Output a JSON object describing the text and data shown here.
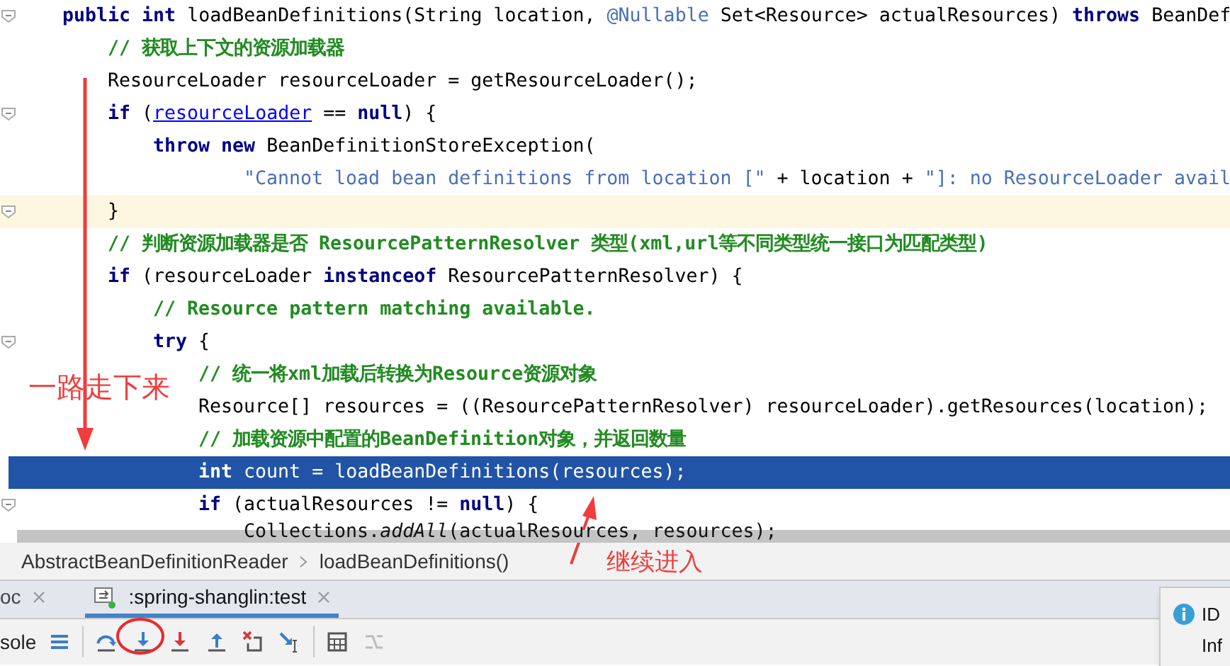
{
  "editor": {
    "lines": [
      {
        "kind": "normal",
        "segments": [
          {
            "kind": "keyword",
            "text": "public int"
          },
          {
            "kind": "plain",
            "text": " loadBeanDefinitions(String location, "
          },
          {
            "kind": "annotation",
            "text": "@Nullable"
          },
          {
            "kind": "plain",
            "text": " Set<Resource> actualResources) "
          },
          {
            "kind": "keyword",
            "text": "throws"
          },
          {
            "kind": "plain",
            "text": " BeanDef"
          }
        ],
        "children": [
          {
            "kind": "normal",
            "segments": [
              {
                "kind": "comment",
                "text": "// 获取上下文的资源加载器"
              }
            ]
          },
          {
            "kind": "normal",
            "segments": [
              {
                "kind": "plain",
                "text": "ResourceLoader resourceLoader = getResourceLoader();"
              }
            ]
          },
          {
            "kind": "normal",
            "segments": [
              {
                "kind": "keyword",
                "text": "if"
              },
              {
                "kind": "plain",
                "text": " ("
              },
              {
                "kind": "link",
                "text": "resourceLoader"
              },
              {
                "kind": "plain",
                "text": " == "
              },
              {
                "kind": "keyword",
                "text": "null"
              },
              {
                "kind": "plain",
                "text": ") {"
              }
            ],
            "children": [
              {
                "kind": "normal",
                "segments": [
                  {
                    "kind": "keyword",
                    "text": "throw new"
                  },
                  {
                    "kind": "plain",
                    "text": " BeanDefinitionStoreException("
                  }
                ],
                "children": [
                  {
                    "kind": "continuation",
                    "segments": [
                      {
                        "kind": "string",
                        "text": "\"Cannot load bean definitions from location [\""
                      },
                      {
                        "kind": "plain",
                        "text": " + location + "
                      },
                      {
                        "kind": "string",
                        "text": "\"]: no ResourceLoader avail"
                      }
                    ]
                  }
                ]
              }
            ]
          },
          {
            "kind": "caret",
            "segments": [
              {
                "kind": "plain",
                "text": "}"
              }
            ]
          },
          {
            "kind": "normal",
            "segments": [
              {
                "kind": "comment",
                "text": "// 判断资源加载器是否  ResourcePatternResolver 类型(xml,url等不同类型统一接口为匹配类型)"
              }
            ]
          },
          {
            "kind": "normal",
            "segments": [
              {
                "kind": "keyword",
                "text": "if"
              },
              {
                "kind": "plain",
                "text": " (resourceLoader "
              },
              {
                "kind": "keyword",
                "text": "instanceof"
              },
              {
                "kind": "plain",
                "text": " ResourcePatternResolver) {"
              }
            ],
            "children": [
              {
                "kind": "normal",
                "segments": [
                  {
                    "kind": "comment",
                    "text": "// Resource pattern matching available."
                  }
                ]
              },
              {
                "kind": "normal",
                "segments": [
                  {
                    "kind": "keyword",
                    "text": "try"
                  },
                  {
                    "kind": "plain",
                    "text": " {"
                  }
                ],
                "children": [
                  {
                    "kind": "normal",
                    "segments": [
                      {
                        "kind": "comment",
                        "text": "// 统一将xml加载后转换为Resource资源对象"
                      }
                    ]
                  },
                  {
                    "kind": "normal",
                    "segments": [
                      {
                        "kind": "plain",
                        "text": "Resource[] resources = ((ResourcePatternResolver) resourceLoader).getResources(location);"
                      }
                    ]
                  },
                  {
                    "kind": "normal",
                    "segments": [
                      {
                        "kind": "comment",
                        "text": "// 加载资源中配置的BeanDefinition对象，并返回数量"
                      }
                    ]
                  },
                  {
                    "kind": "execution",
                    "segments": [
                      {
                        "kind": "keyword",
                        "text": "int"
                      },
                      {
                        "kind": "plain",
                        "text": " count = loadBeanDefinitions(resources);"
                      }
                    ]
                  },
                  {
                    "kind": "normal",
                    "segments": [
                      {
                        "kind": "keyword",
                        "text": "if"
                      },
                      {
                        "kind": "plain",
                        "text": " (actualResources != "
                      },
                      {
                        "kind": "keyword",
                        "text": "null"
                      },
                      {
                        "kind": "plain",
                        "text": ") {"
                      }
                    ],
                    "children": [
                      {
                        "kind": "normal",
                        "segments": [
                          {
                            "kind": "plain",
                            "text": "Collections."
                          },
                          {
                            "kind": "italic",
                            "text": "addAll"
                          },
                          {
                            "kind": "plain",
                            "text": "(actualResources, resources);"
                          }
                        ]
                      }
                    ]
                  }
                ]
              }
            ]
          }
        ]
      }
    ]
  },
  "annotations": [
    {
      "text": "一路走下来"
    },
    {
      "text": "继续进入"
    }
  ],
  "breadcrumbs": [
    {
      "text": "AbstractBeanDefinitionReader"
    },
    {
      "text": "loadBeanDefinitions()"
    }
  ],
  "tabs": [
    {
      "label": "oc",
      "selected": false
    },
    {
      "label": ":spring-shanglin:test",
      "selected": true
    }
  ],
  "toolbar": {
    "label": "sole"
  },
  "notification": {
    "title": "ID",
    "body": "Inf"
  }
}
